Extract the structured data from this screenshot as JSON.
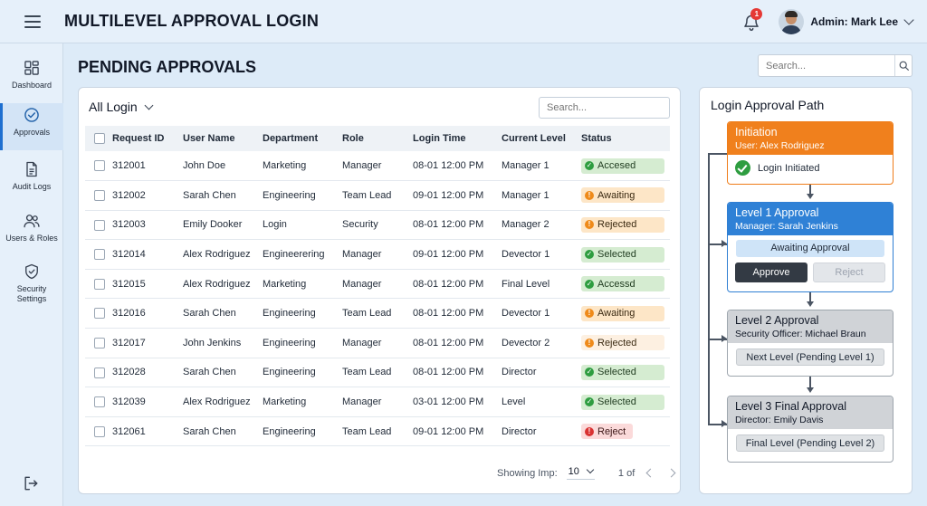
{
  "header": {
    "title": "MULTILEVEL APPROVAL LOGIN",
    "notification_count": "1",
    "user_label": "Admin: Mark Lee"
  },
  "sidebar": {
    "items": [
      {
        "label": "Dashboard",
        "icon": "dashboard-icon"
      },
      {
        "label": "Approvals",
        "icon": "check-circle-icon"
      },
      {
        "label": "Audit Logs",
        "icon": "document-icon"
      },
      {
        "label": "Users & Roles",
        "icon": "users-icon"
      },
      {
        "label": "Security Settings",
        "icon": "shield-check-icon"
      }
    ],
    "active": "Approvals",
    "logout_icon": "logout-icon"
  },
  "main": {
    "page_title": "PENDING APPROVALS",
    "search_placeholder": "Search..."
  },
  "table_card": {
    "filter_label": "All Login",
    "search_placeholder": "Search...",
    "columns": [
      "Request ID",
      "User Name",
      "Department",
      "Role",
      "Login Time",
      "Current Level",
      "Status"
    ],
    "rows": [
      {
        "id": "312001",
        "user": "John Doe",
        "dept": "Marketing",
        "role": "Manager",
        "time": "08-01 12:00 PM",
        "level": "Manager 1",
        "status": "Accesed",
        "tone": "green"
      },
      {
        "id": "312002",
        "user": "Sarah Chen",
        "dept": "Engineering",
        "role": "Team Lead",
        "time": "09-01 12:00 PM",
        "level": "Manager 1",
        "status": "Awaiting",
        "tone": "orange"
      },
      {
        "id": "312003",
        "user": "Emily Dooker",
        "dept": "Login",
        "role": "Security",
        "time": "08-01 12:00 PM",
        "level": "Manager 2",
        "status": "Rejected",
        "tone": "orange"
      },
      {
        "id": "312014",
        "user": "Alex Rodriguez",
        "dept": "Engineerering",
        "role": "Manager",
        "time": "09-01 12:00 PM",
        "level": "Devector 1",
        "status": "Selected",
        "tone": "green"
      },
      {
        "id": "312015",
        "user": "Alex Rodriguez",
        "dept": "Marketing",
        "role": "Manager",
        "time": "08-01 12:00 PM",
        "level": "Final Level",
        "status": "Accessd",
        "tone": "green"
      },
      {
        "id": "312016",
        "user": "Sarah Chen",
        "dept": "Engineering",
        "role": "Team Lead",
        "time": "08-01 12:00 PM",
        "level": "Devector 1",
        "status": "Awaiting",
        "tone": "orange"
      },
      {
        "id": "312017",
        "user": "John Jenkins",
        "dept": "Engineering",
        "role": "Manager",
        "time": "08-01 12:00 PM",
        "level": "Devector 2",
        "status": "Rejected",
        "tone": "orange-light"
      },
      {
        "id": "312028",
        "user": "Sarah Chen",
        "dept": "Engineering",
        "role": "Team Lead",
        "time": "08-01 12:00 PM",
        "level": "Director",
        "status": "Selected",
        "tone": "green"
      },
      {
        "id": "312039",
        "user": "Alex Rodriguez",
        "dept": "Marketing",
        "role": "Manager",
        "time": "03-01 12:00 PM",
        "level": "Level",
        "status": "Selected",
        "tone": "green"
      },
      {
        "id": "312061",
        "user": "Sarah Chen",
        "dept": "Engineering",
        "role": "Team Lead",
        "time": "09-01 12:00 PM",
        "level": "Director",
        "status": "Reject",
        "tone": "red"
      }
    ],
    "pager": {
      "showing_label": "Showing Imp:",
      "page_size": "10",
      "page_info": "1 of"
    }
  },
  "approval_path": {
    "title": "Login Approval Path",
    "steps": [
      {
        "title": "Initiation",
        "subtitle": "User: Alex Rodriguez",
        "status": "Login Initiated",
        "color": "#f0801d"
      },
      {
        "title": "Level 1 Approval",
        "subtitle": "Manager: Sarah Jenkins",
        "status": "Awaiting Approval",
        "approve_label": "Approve",
        "reject_label": "Reject",
        "color": "#2f81d6"
      },
      {
        "title": "Level 2 Approval",
        "subtitle": "Security Officer: Michael Braun",
        "status": "Next Level (Pending Level 1)",
        "color": "#d0d3d7"
      },
      {
        "title": "Level 3 Final Approval",
        "subtitle": "Director: Emily Davis",
        "status": "Final Level (Pending Level 2)",
        "color": "#d0d3d7"
      }
    ]
  }
}
